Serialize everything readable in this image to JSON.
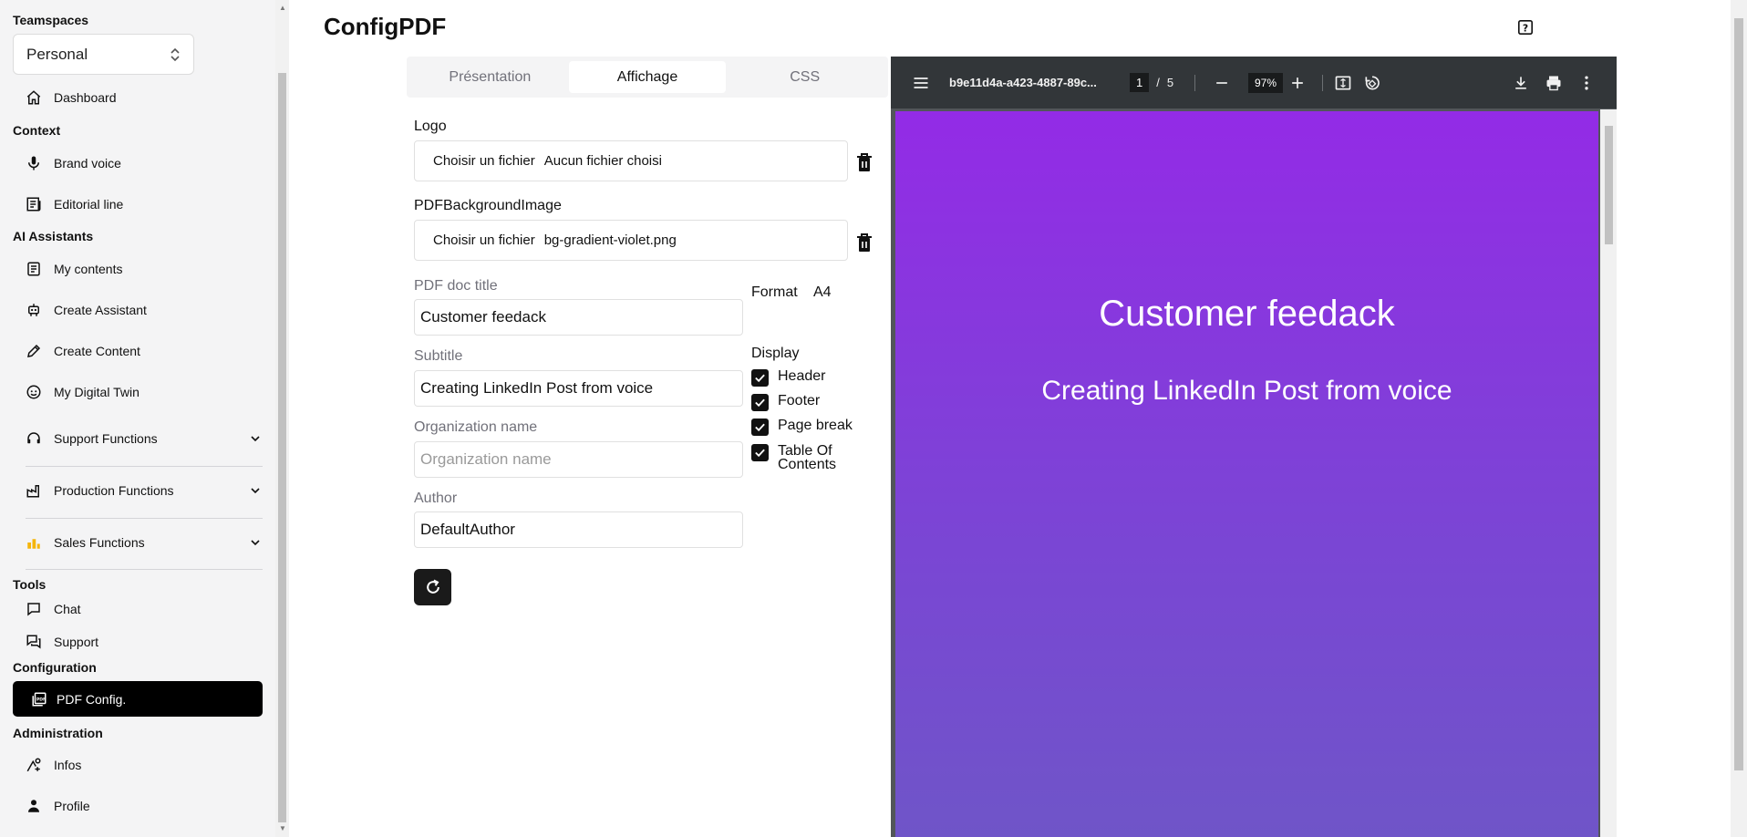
{
  "sidebar": {
    "teamspaces_title": "Teamspaces",
    "team_selected": "Personal",
    "dashboard": "Dashboard",
    "context_title": "Context",
    "brand_voice": "Brand voice",
    "editorial_line": "Editorial line",
    "ai_title": "AI Assistants",
    "my_contents": "My contents",
    "create_assistant": "Create Assistant",
    "create_content": "Create Content",
    "digital_twin": "My Digital Twin",
    "support_functions": "Support Functions",
    "production_functions": "Production Functions",
    "sales_functions": "Sales Functions",
    "tools_title": "Tools",
    "chat": "Chat",
    "support": "Support",
    "configuration_title": "Configuration",
    "pdf_config": "PDF Config.",
    "administration_title": "Administration",
    "infos": "Infos",
    "profile": "Profile"
  },
  "header": {
    "title": "ConfigPDF"
  },
  "tabs": [
    {
      "label": "Présentation",
      "active": false
    },
    {
      "label": "Affichage",
      "active": true
    },
    {
      "label": "CSS",
      "active": false
    }
  ],
  "form": {
    "logo_label": "Logo",
    "logo_button": "Choisir un fichier",
    "logo_file": "Aucun fichier choisi",
    "bg_label": "PDFBackgroundImage",
    "bg_button": "Choisir un fichier",
    "bg_file": "bg-gradient-violet.png",
    "doc_title_label": "PDF doc title",
    "doc_title_value": "Customer feedack",
    "subtitle_label": "Subtitle",
    "subtitle_value": "Creating LinkedIn Post from voice",
    "org_label": "Organization name",
    "org_placeholder": "Organization name",
    "author_label": "Author",
    "author_value": "DefaultAuthor",
    "format_label": "Format",
    "format_value": "A4",
    "display_label": "Display",
    "display_header": "Header",
    "display_footer": "Footer",
    "display_pagebreak": "Page break",
    "display_toc_1": "Table Of",
    "display_toc_2": "Contents"
  },
  "viewer": {
    "filename": "b9e11d4a-a423-4887-89c...",
    "current_page": "1",
    "page_sep": "/",
    "total_pages": "5",
    "zoom": "97%",
    "page_title": "Customer feedack",
    "page_subtitle": "Creating LinkedIn Post from voice"
  },
  "colors": {
    "accent": "#000000",
    "pdf_gradient_top": "#932be6",
    "pdf_gradient_bottom": "#6f55c8"
  }
}
